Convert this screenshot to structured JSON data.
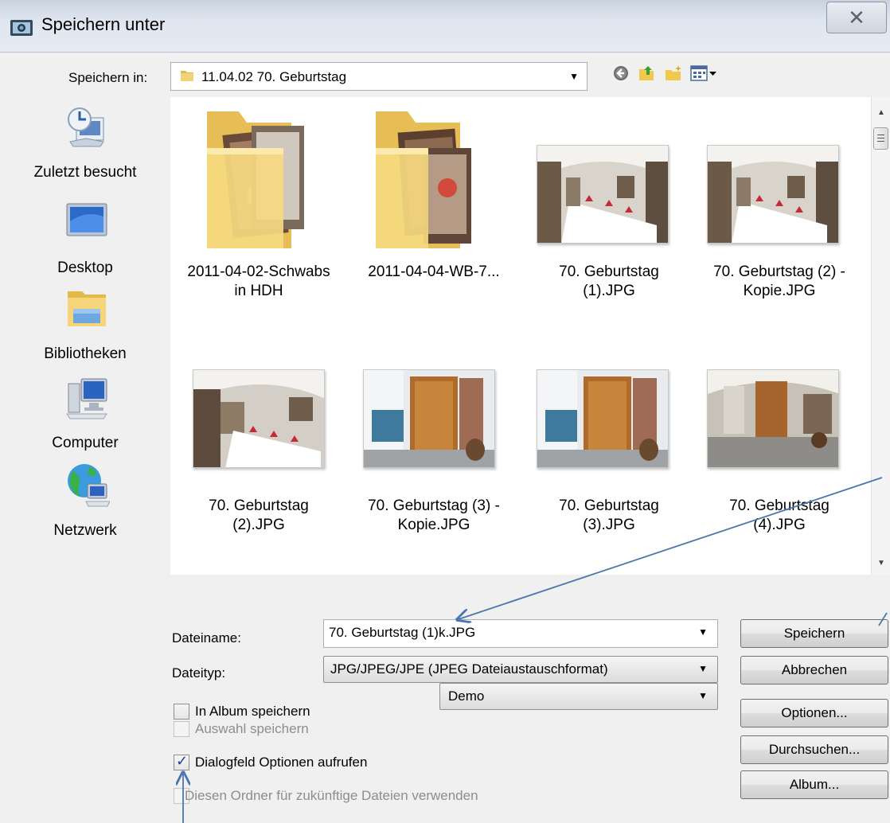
{
  "window": {
    "title": "Speichern unter"
  },
  "save_in": {
    "label": "Speichern in:",
    "value": "11.04.02 70. Geburtstag"
  },
  "places": [
    {
      "label": "Zuletzt besucht",
      "icon": "recent-places-icon"
    },
    {
      "label": "Desktop",
      "icon": "desktop-icon"
    },
    {
      "label": "Bibliotheken",
      "icon": "libraries-icon"
    },
    {
      "label": "Computer",
      "icon": "computer-icon"
    },
    {
      "label": "Netzwerk",
      "icon": "network-icon"
    }
  ],
  "files": [
    {
      "line1": "2011-04-02-Schwabs",
      "line2": "in HDH",
      "type": "folder"
    },
    {
      "line1": "2011-04-04-WB-7...",
      "line2": "",
      "type": "folder"
    },
    {
      "line1": "70. Geburtstag",
      "line2": "(1).JPG",
      "type": "photo-hall"
    },
    {
      "line1": "70. Geburtstag  (2) -",
      "line2": "Kopie.JPG",
      "type": "photo-hall"
    },
    {
      "line1": "70. Geburtstag",
      "line2": "(2).JPG",
      "type": "photo-hall"
    },
    {
      "line1": "70. Geburtstag  (3) -",
      "line2": "Kopie.JPG",
      "type": "photo-door"
    },
    {
      "line1": "70. Geburtstag",
      "line2": "(3).JPG",
      "type": "photo-door"
    },
    {
      "line1": "70. Geburtstag",
      "line2": "(4).JPG",
      "type": "photo-door"
    }
  ],
  "filename": {
    "label": "Dateiname:",
    "value": "70. Geburtstag  (1)k.JPG"
  },
  "filetype": {
    "label": "Dateityp:",
    "value": "JPG/JPEG/JPE (JPEG Dateiaustauschformat)"
  },
  "album": {
    "checkbox_label": "In Album speichern",
    "checked": false,
    "select_value": "Demo"
  },
  "save_selection": {
    "label": "Auswahl speichern",
    "enabled": false
  },
  "show_options": {
    "label": "Dialogfeld Optionen aufrufen",
    "checked": true
  },
  "use_folder": {
    "label": "Diesen Ordner für zukünftige Dateien verwenden",
    "enabled": false
  },
  "buttons": {
    "save": "Speichern",
    "cancel": "Abbrechen",
    "options": "Optionen...",
    "browse": "Durchsuchen...",
    "album": "Album..."
  },
  "colors": {
    "annotation_arrow": "#4a76b0",
    "checkmark": "#1c3f91",
    "folder": "#f2d377"
  }
}
